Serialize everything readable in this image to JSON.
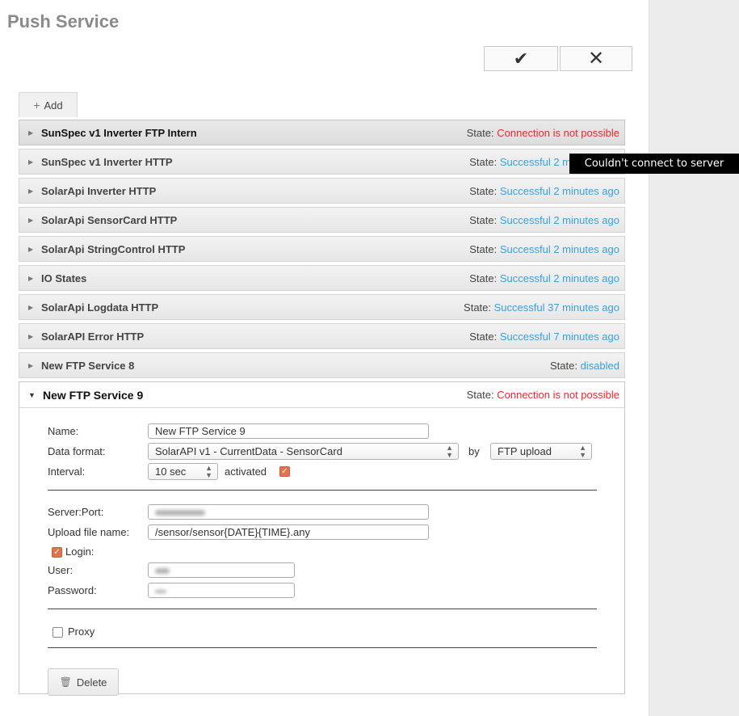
{
  "page_title": "Push Service",
  "toolbar": {
    "ok_symbol": "✔",
    "cancel_symbol": "✕"
  },
  "add_button": {
    "icon": "+",
    "label": "Add"
  },
  "state_label": "State:",
  "services": [
    {
      "name": "SunSpec v1 Inverter FTP Intern",
      "state": "Connection is not possible",
      "status": "error"
    },
    {
      "name": "SunSpec v1 Inverter HTTP",
      "state": "Successful 2 minutes ago",
      "status": "ok"
    },
    {
      "name": "SolarApi Inverter HTTP",
      "state": "Successful 2 minutes ago",
      "status": "ok"
    },
    {
      "name": "SolarApi SensorCard HTTP",
      "state": "Successful 2 minutes ago",
      "status": "ok"
    },
    {
      "name": "SolarApi StringControl HTTP",
      "state": "Successful 2 minutes ago",
      "status": "ok"
    },
    {
      "name": "IO States",
      "state": "Successful 2 minutes ago",
      "status": "ok"
    },
    {
      "name": "SolarApi Logdata HTTP",
      "state": "Successful 37 minutes ago",
      "status": "ok"
    },
    {
      "name": "SolarAPI Error HTTP",
      "state": "Successful 7 minutes ago",
      "status": "ok"
    },
    {
      "name": "New FTP Service 8",
      "state": "disabled",
      "status": "ok"
    }
  ],
  "expanded": {
    "name": "New FTP Service 9",
    "state": "Connection is not possible",
    "form": {
      "name_label": "Name:",
      "name_value": "New FTP Service 9",
      "data_format_label": "Data format:",
      "data_format_value": "SolarAPI v1 - CurrentData - SensorCard",
      "by_label": "by",
      "method_value": "FTP upload",
      "interval_label": "Interval:",
      "interval_value": "10 sec",
      "activated_label": "activated",
      "activated": true,
      "server_port_label": "Server:Port:",
      "upload_file_name_label": "Upload file name:",
      "upload_file_name_value": "/sensor/sensor{DATE}{TIME}.any",
      "login_label": "Login:",
      "login": true,
      "user_label": "User:",
      "password_label": "Password:",
      "proxy_label": "Proxy",
      "proxy": false,
      "delete_label": "Delete"
    }
  },
  "tooltip": "Couldn't connect to server",
  "colors": {
    "ok": "#3aa0dd",
    "error": "#e32c2c",
    "checkbox": "#e2744d"
  },
  "icons": {
    "collapsed": "triangle-right-icon",
    "expanded": "triangle-down-icon",
    "delete": "trash-icon"
  }
}
